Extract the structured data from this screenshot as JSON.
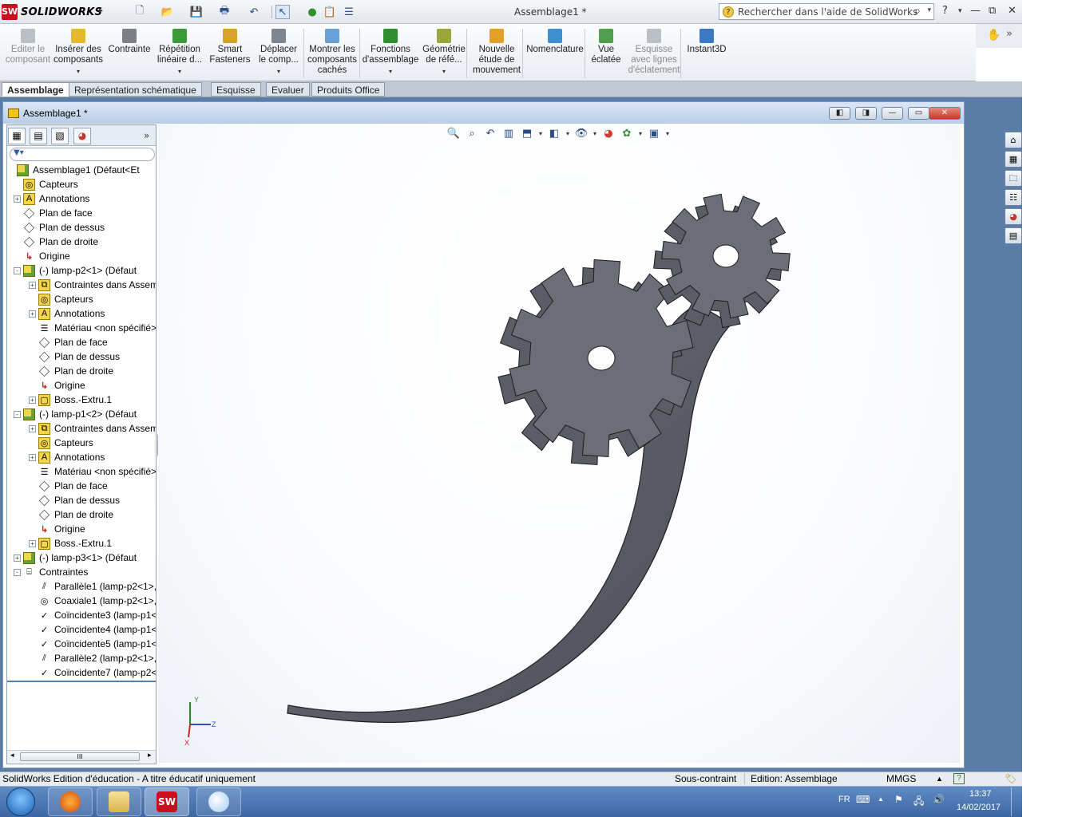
{
  "app": {
    "logo_text": "SOLIDWORKS",
    "logo_mark": "SW",
    "document_title": "Assemblage1 *",
    "search_placeholder": "Rechercher dans l'aide de SolidWorks",
    "help_glyph": "?"
  },
  "ribbon": {
    "buttons": [
      {
        "label": "Editer le composant",
        "icon": "edit-component-icon",
        "enabled": false
      },
      {
        "label": "Insérer des composants",
        "icon": "insert-components-icon",
        "enabled": true
      },
      {
        "label": "Contrainte",
        "icon": "mate-icon",
        "enabled": true
      },
      {
        "label": "Répétition linéaire d...",
        "icon": "linear-pattern-icon",
        "enabled": true
      },
      {
        "label": "Smart Fasteners",
        "icon": "smart-fasteners-icon",
        "enabled": true
      },
      {
        "label": "Déplacer le comp...",
        "icon": "move-component-icon",
        "enabled": true
      },
      {
        "label": "Montrer les composants cachés",
        "icon": "show-hidden-icon",
        "enabled": true
      },
      {
        "label": "Fonctions d'assemblage",
        "icon": "assembly-features-icon",
        "enabled": true
      },
      {
        "label": "Géométrie de réfé...",
        "icon": "reference-geometry-icon",
        "enabled": true
      },
      {
        "label": "Nouvelle étude de mouvement",
        "icon": "motion-study-icon",
        "enabled": true
      },
      {
        "label": "Nomenclature",
        "icon": "bom-icon",
        "enabled": true
      },
      {
        "label": "Vue éclatée",
        "icon": "exploded-view-icon",
        "enabled": true
      },
      {
        "label": "Esquisse avec lignes d'éclatement",
        "icon": "explode-line-sketch-icon",
        "enabled": false
      },
      {
        "label": "Instant3D",
        "icon": "instant3d-icon",
        "enabled": true
      }
    ]
  },
  "tabs": [
    "Assemblage",
    "Représentation schématique",
    "Esquisse",
    "Evaluer",
    "Produits Office"
  ],
  "document_window": {
    "title": "Assemblage1 *"
  },
  "tree": [
    {
      "label": "Assemblage1  (Défaut<Et",
      "level": 0,
      "icon": "assembly",
      "exp": ""
    },
    {
      "label": "Capteurs",
      "level": 1,
      "icon": "sensor",
      "exp": ""
    },
    {
      "label": "Annotations",
      "level": 1,
      "icon": "annotation",
      "exp": "+"
    },
    {
      "label": "Plan de face",
      "level": 1,
      "icon": "plane",
      "exp": ""
    },
    {
      "label": "Plan de dessus",
      "level": 1,
      "icon": "plane",
      "exp": ""
    },
    {
      "label": "Plan de droite",
      "level": 1,
      "icon": "plane",
      "exp": ""
    },
    {
      "label": "Origine",
      "level": 1,
      "icon": "origin",
      "exp": ""
    },
    {
      "label": "(-) lamp-p2<1> (Défaut",
      "level": 1,
      "icon": "part",
      "exp": "-"
    },
    {
      "label": "Contraintes dans Assem",
      "level": 2,
      "icon": "mategroup",
      "exp": "+"
    },
    {
      "label": "Capteurs",
      "level": 2,
      "icon": "sensor",
      "exp": ""
    },
    {
      "label": "Annotations",
      "level": 2,
      "icon": "annotation",
      "exp": "+"
    },
    {
      "label": "Matériau <non spécifié>",
      "level": 2,
      "icon": "material",
      "exp": ""
    },
    {
      "label": "Plan de face",
      "level": 2,
      "icon": "plane",
      "exp": ""
    },
    {
      "label": "Plan de dessus",
      "level": 2,
      "icon": "plane",
      "exp": ""
    },
    {
      "label": "Plan de droite",
      "level": 2,
      "icon": "plane",
      "exp": ""
    },
    {
      "label": "Origine",
      "level": 2,
      "icon": "origin",
      "exp": ""
    },
    {
      "label": "Boss.-Extru.1",
      "level": 2,
      "icon": "extrude",
      "exp": "+"
    },
    {
      "label": "(-) lamp-p1<2> (Défaut",
      "level": 1,
      "icon": "part",
      "exp": "-"
    },
    {
      "label": "Contraintes dans Assem",
      "level": 2,
      "icon": "mategroup",
      "exp": "+"
    },
    {
      "label": "Capteurs",
      "level": 2,
      "icon": "sensor",
      "exp": ""
    },
    {
      "label": "Annotations",
      "level": 2,
      "icon": "annotation",
      "exp": "+"
    },
    {
      "label": "Matériau <non spécifié>",
      "level": 2,
      "icon": "material",
      "exp": ""
    },
    {
      "label": "Plan de face",
      "level": 2,
      "icon": "plane",
      "exp": ""
    },
    {
      "label": "Plan de dessus",
      "level": 2,
      "icon": "plane",
      "exp": ""
    },
    {
      "label": "Plan de droite",
      "level": 2,
      "icon": "plane",
      "exp": ""
    },
    {
      "label": "Origine",
      "level": 2,
      "icon": "origin",
      "exp": ""
    },
    {
      "label": "Boss.-Extru.1",
      "level": 2,
      "icon": "extrude",
      "exp": "+"
    },
    {
      "label": "(-) lamp-p3<1> (Défaut",
      "level": 1,
      "icon": "part",
      "exp": "+"
    },
    {
      "label": "Contraintes",
      "level": 1,
      "icon": "mates",
      "exp": "-"
    },
    {
      "label": "Parallèle1 (lamp-p2<1>,",
      "level": 2,
      "icon": "parallel",
      "exp": ""
    },
    {
      "label": "Coaxiale1 (lamp-p2<1>,",
      "level": 2,
      "icon": "coaxial",
      "exp": ""
    },
    {
      "label": "Coïncidente3 (lamp-p1<",
      "level": 2,
      "icon": "coincident",
      "exp": ""
    },
    {
      "label": "Coïncidente4 (lamp-p1<",
      "level": 2,
      "icon": "coincident",
      "exp": ""
    },
    {
      "label": "Coïncidente5 (lamp-p1<",
      "level": 2,
      "icon": "coincident",
      "exp": ""
    },
    {
      "label": "Parallèle2 (lamp-p2<1>,",
      "level": 2,
      "icon": "parallel",
      "exp": ""
    },
    {
      "label": "Coïncidente7 (lamp-p2<",
      "level": 2,
      "icon": "coincident",
      "exp": ""
    }
  ],
  "triad": {
    "x": "X",
    "y": "Y",
    "z": "Z"
  },
  "status": {
    "edition_note": "SolidWorks Edition d'éducation - A titre éducatif uniquement",
    "constraint_state": "Sous-contraint",
    "edit_mode": "Edition: Assemblage",
    "units": "MMGS"
  },
  "taskbar": {
    "lang": "FR",
    "time": "13:37",
    "date": "14/02/2017"
  },
  "colors": {
    "part": "#5b5d66",
    "part_edge": "#1c1c20",
    "viewport_bg": "#ffffff",
    "taskbar": "#3c67a3"
  }
}
